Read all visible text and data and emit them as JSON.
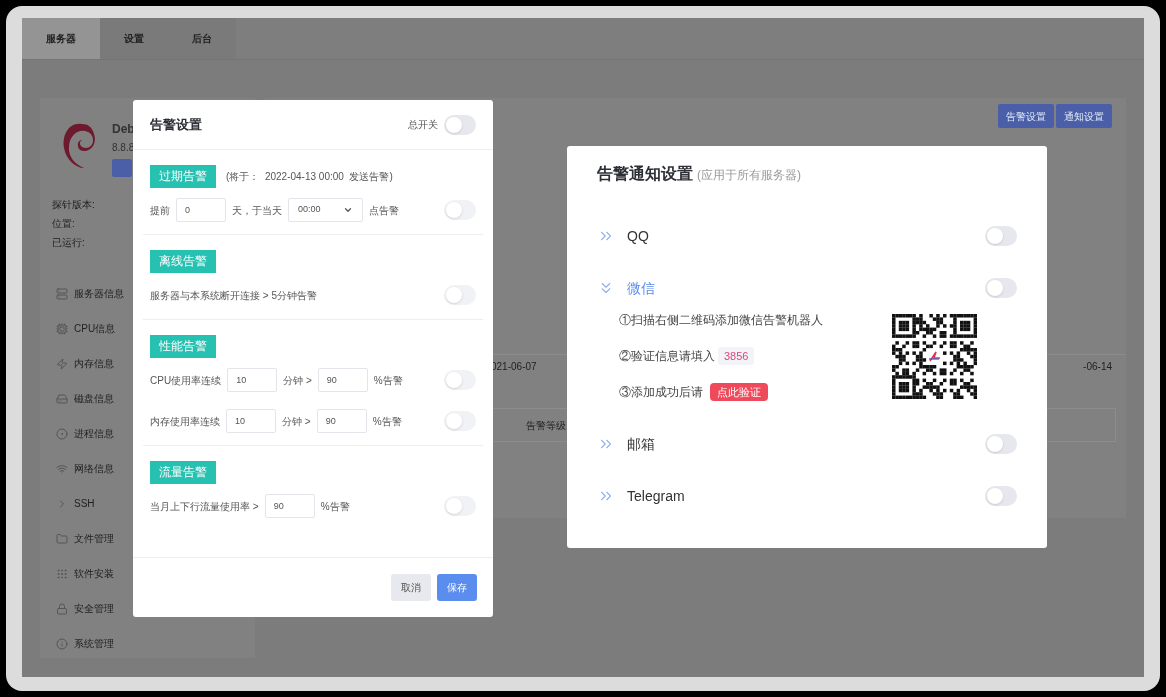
{
  "tabs": [
    {
      "label": "服务器",
      "selected": true
    },
    {
      "label": "设置",
      "selected": false
    },
    {
      "label": "后台",
      "selected": false
    }
  ],
  "server": {
    "name": "Deb",
    "version": "8.8.8"
  },
  "info_labels": [
    "探针版本:",
    "位置:",
    "已运行:"
  ],
  "sidebar": {
    "items": [
      {
        "label": "服务器信息"
      },
      {
        "label": "CPU信息"
      },
      {
        "label": "内存信息"
      },
      {
        "label": "磁盘信息"
      },
      {
        "label": "进程信息"
      },
      {
        "label": "网络信息"
      },
      {
        "label": "SSH"
      },
      {
        "label": "文件管理"
      },
      {
        "label": "软件安装"
      },
      {
        "label": "安全管理"
      },
      {
        "label": "系统管理"
      }
    ]
  },
  "toolbar_buttons": [
    "告警设置",
    "通知设置"
  ],
  "axis_labels": [
    "021-06-07",
    "-06-14"
  ],
  "table": {
    "columns": [
      "告警等级"
    ]
  },
  "alert_modal": {
    "title": "告警设置",
    "master": {
      "label": "总开关",
      "on": false
    },
    "sections": [
      {
        "tag": "过期告警",
        "note": "(将于：  2022-04-13 00:00  发送告警)",
        "rows": [
          {
            "on": false,
            "parts": [
              {
                "kind": "text",
                "text": "提前"
              },
              {
                "kind": "input",
                "value": "0"
              },
              {
                "kind": "text",
                "text": "天，于当天"
              },
              {
                "kind": "select",
                "value": "00:00"
              },
              {
                "kind": "text",
                "text": "点告警"
              }
            ]
          }
        ]
      },
      {
        "tag": "离线告警",
        "rows": [
          {
            "on": false,
            "parts": [
              {
                "kind": "text",
                "text": "服务器与本系统断开连接 > 5分钟告警"
              }
            ]
          }
        ]
      },
      {
        "tag": "性能告警",
        "rows": [
          {
            "on": false,
            "parts": [
              {
                "kind": "text",
                "text": "CPU使用率连续"
              },
              {
                "kind": "input",
                "value": "10"
              },
              {
                "kind": "text",
                "text": "分钟 >"
              },
              {
                "kind": "input",
                "value": "90"
              },
              {
                "kind": "text",
                "text": "%告警"
              }
            ]
          },
          {
            "on": false,
            "parts": [
              {
                "kind": "text",
                "text": "内存使用率连续"
              },
              {
                "kind": "input",
                "value": "10"
              },
              {
                "kind": "text",
                "text": "分钟 >"
              },
              {
                "kind": "input",
                "value": "90"
              },
              {
                "kind": "text",
                "text": "%告警"
              }
            ]
          }
        ]
      },
      {
        "tag": "流量告警",
        "rows": [
          {
            "on": false,
            "parts": [
              {
                "kind": "text",
                "text": "当月上下行流量使用率 >"
              },
              {
                "kind": "input",
                "value": "90"
              },
              {
                "kind": "text",
                "text": "%告警"
              }
            ]
          }
        ]
      }
    ],
    "buttons": [
      {
        "kind": "cancel",
        "label": "取消"
      },
      {
        "kind": "save",
        "label": "保存"
      }
    ]
  },
  "notify_modal": {
    "title": "告警通知设置",
    "subtitle": "(应用于所有服务器)",
    "channels": [
      {
        "name": "QQ",
        "expanded": false,
        "on": false
      },
      {
        "name": "微信",
        "expanded": true,
        "on": false,
        "steps": [
          {
            "kind": "text",
            "text": "①扫描右侧二维码添加微信告警机器人"
          },
          {
            "kind": "code",
            "text": "②验证信息请填入",
            "code": "3856"
          },
          {
            "kind": "action",
            "text": "③添加成功后请",
            "action": "点此验证"
          }
        ]
      },
      {
        "name": "邮箱",
        "expanded": false,
        "on": false
      },
      {
        "name": "Telegram",
        "expanded": false,
        "on": false
      }
    ]
  }
}
